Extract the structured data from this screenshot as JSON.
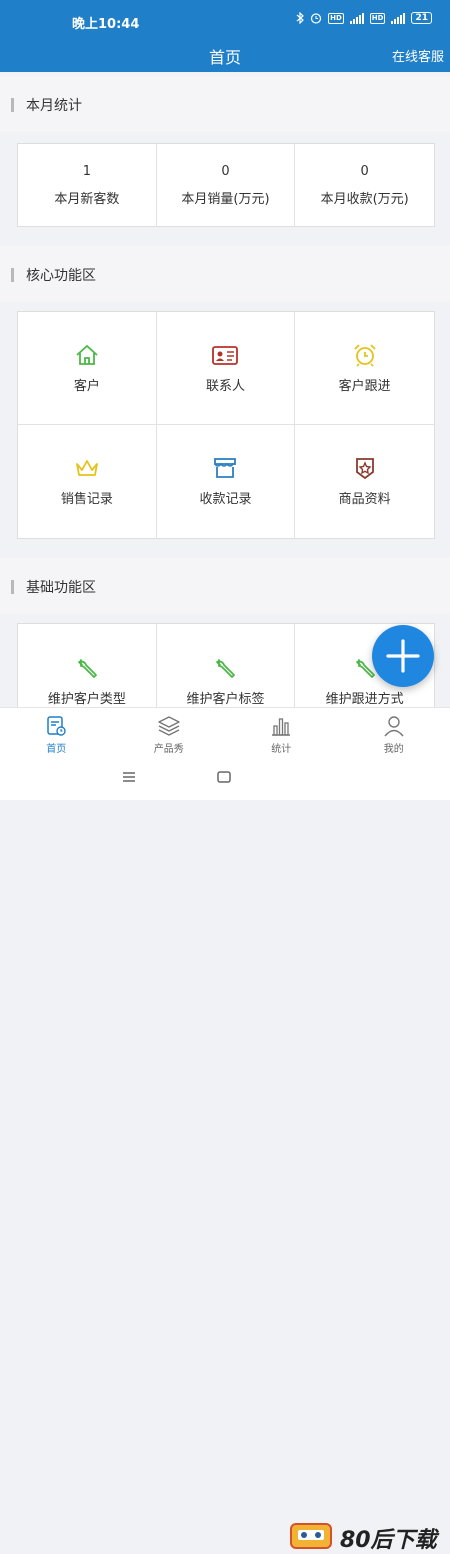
{
  "status_bar": {
    "time": "晚上10:44",
    "battery": "21"
  },
  "header": {
    "title": "首页",
    "customer_service": "在线客服"
  },
  "sections": {
    "monthly": "本月统计",
    "core": "核心功能区",
    "basic": "基础功能区"
  },
  "stats": [
    {
      "value": "1",
      "label": "本月新客数"
    },
    {
      "value": "0",
      "label": "本月销量(万元)"
    },
    {
      "value": "0",
      "label": "本月收款(万元)"
    }
  ],
  "core_features": [
    {
      "label": "客户",
      "icon": "home-icon"
    },
    {
      "label": "联系人",
      "icon": "id-card-icon"
    },
    {
      "label": "客户跟进",
      "icon": "alarm-clock-icon"
    },
    {
      "label": "销售记录",
      "icon": "crown-icon"
    },
    {
      "label": "收款记录",
      "icon": "store-icon"
    },
    {
      "label": "商品资料",
      "icon": "star-badge-icon"
    }
  ],
  "basic_features": [
    {
      "label": "维护客户类型",
      "icon": "wrench-icon"
    },
    {
      "label": "维护客户标签",
      "icon": "wrench-icon"
    },
    {
      "label": "维护跟进方式",
      "icon": "wrench-icon"
    }
  ],
  "tabs": [
    {
      "label": "首页",
      "icon": "home-doc-icon",
      "active": true
    },
    {
      "label": "产品秀",
      "icon": "layers-icon",
      "active": false
    },
    {
      "label": "统计",
      "icon": "bar-chart-icon",
      "active": false
    },
    {
      "label": "我的",
      "icon": "user-icon",
      "active": false
    }
  ],
  "watermark": "80后下载",
  "colors": {
    "primary": "#1f7fc8",
    "green": "#4cb848",
    "red": "#b5322a",
    "yellow": "#e6c21b",
    "blue": "#2e7fc0",
    "brown": "#8b3a2e"
  }
}
